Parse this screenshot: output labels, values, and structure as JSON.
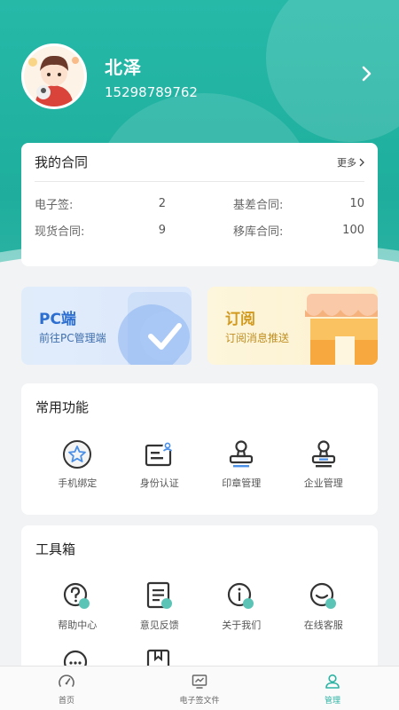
{
  "profile": {
    "name": "北泽",
    "phone": "15298789762"
  },
  "contracts": {
    "title": "我的合同",
    "more": "更多",
    "stats": [
      {
        "label": "电子签:",
        "value": "2"
      },
      {
        "label": "基差合同:",
        "value": "10"
      },
      {
        "label": "现货合同:",
        "value": "9"
      },
      {
        "label": "移库合同:",
        "value": "100"
      }
    ]
  },
  "promos": {
    "pc": {
      "title": "PC端",
      "desc": "前往PC管理端"
    },
    "subscribe": {
      "title": "订阅",
      "desc": "订阅消息推送"
    }
  },
  "functions": {
    "title": "常用功能",
    "items": [
      {
        "label": "手机绑定",
        "icon": "star-badge-icon"
      },
      {
        "label": "身份认证",
        "icon": "id-card-icon"
      },
      {
        "label": "印章管理",
        "icon": "stamp-icon"
      },
      {
        "label": "企业管理",
        "icon": "enterprise-stamp-icon"
      }
    ]
  },
  "tools": {
    "title": "工具箱",
    "items": [
      {
        "label": "帮助中心",
        "icon": "help-icon"
      },
      {
        "label": "意见反馈",
        "icon": "feedback-icon"
      },
      {
        "label": "关于我们",
        "icon": "info-icon"
      },
      {
        "label": "在线客服",
        "icon": "service-icon"
      },
      {
        "label": "",
        "icon": "chat-icon"
      },
      {
        "label": "",
        "icon": "book-icon"
      }
    ]
  },
  "tabs": [
    {
      "label": "首页",
      "icon": "dashboard-icon",
      "active": false
    },
    {
      "label": "电子签文件",
      "icon": "monitor-chart-icon",
      "active": false
    },
    {
      "label": "管理",
      "icon": "user-manage-icon",
      "active": true
    }
  ],
  "colors": {
    "primary": "#2cb3a4",
    "header": "#1fae9d",
    "pc_accent": "#2c6fd1",
    "subscribe_accent": "#d29a1f"
  }
}
